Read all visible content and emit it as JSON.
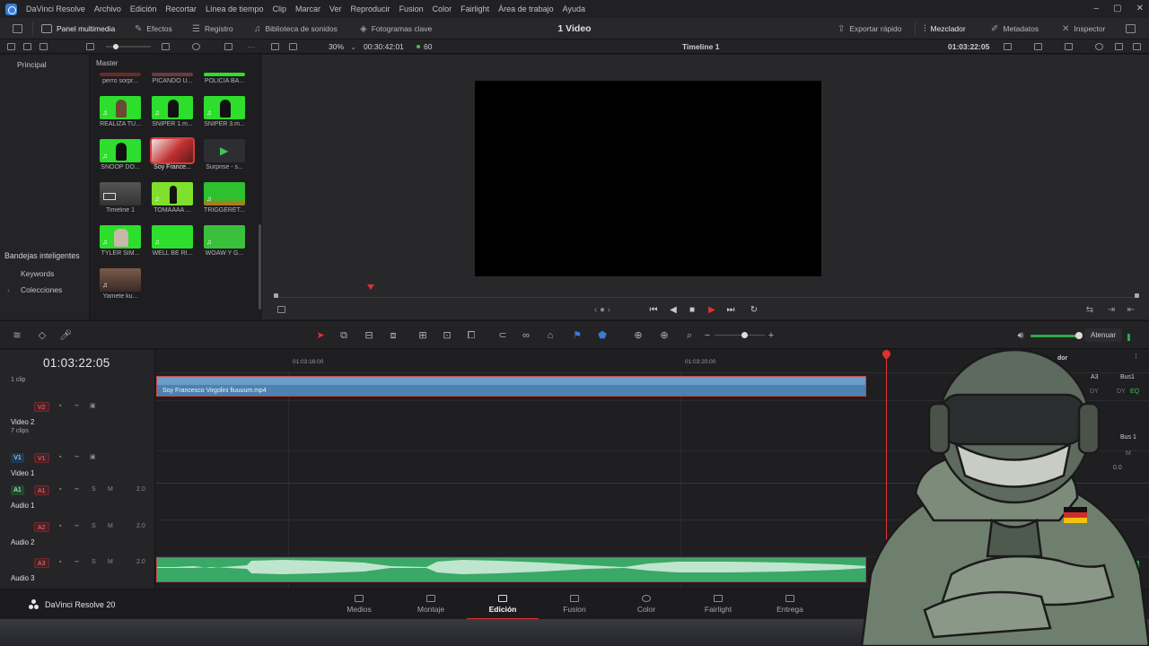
{
  "app": {
    "name": "DaVinci Resolve",
    "menu": [
      "Archivo",
      "Edición",
      "Recortar",
      "Línea de tiempo",
      "Clip",
      "Marcar",
      "Ver",
      "Reproducir",
      "Fusion",
      "Color",
      "Fairlight",
      "Área de trabajo",
      "Ayuda"
    ],
    "window_controls": [
      "–",
      "▢",
      "✕"
    ]
  },
  "toolbar": {
    "left": [
      "Panel multimedia",
      "Efectos",
      "Registro",
      "Biblioteca de sonidos",
      "Fotogramas clave"
    ],
    "project_title": "1 Video",
    "right": [
      "Exportar rápido",
      "Mezclador",
      "Metadatos",
      "Inspector"
    ]
  },
  "subtoolbar": {
    "zoom": "30%",
    "source_timecode": "00:30:42:01",
    "fps": "60",
    "timeline_name": "Timeline 1",
    "record_timecode": "01:03:22:05"
  },
  "left_panel": {
    "principal": "Principal",
    "smart_bins_title": "Bandejas inteligentes",
    "smart_bins": [
      "Keywords",
      "Colecciones"
    ]
  },
  "media_pool": {
    "bin": "Master",
    "clips": [
      {
        "name": "perro sorpr...",
        "kind": "partial"
      },
      {
        "name": "PICANDO U...",
        "kind": "partial"
      },
      {
        "name": "POLICIA BA...",
        "kind": "partial"
      },
      {
        "name": "REALIZA TU...",
        "kind": "green"
      },
      {
        "name": "SNIPER 1.m...",
        "kind": "green"
      },
      {
        "name": "SNIPER 3.m...",
        "kind": "green"
      },
      {
        "name": "SNOOP DO...",
        "kind": "green"
      },
      {
        "name": "Soy France...",
        "kind": "selected"
      },
      {
        "name": "Surprise - s...",
        "kind": "audio"
      },
      {
        "name": "Timeline 1",
        "kind": "timeline"
      },
      {
        "name": "TOMAAAA ...",
        "kind": "green"
      },
      {
        "name": "TRIGGERET...",
        "kind": "green"
      },
      {
        "name": "TYLER SIM...",
        "kind": "green"
      },
      {
        "name": "WELL BE RI...",
        "kind": "green"
      },
      {
        "name": "WOAW Y G...",
        "kind": "green"
      },
      {
        "name": "Yamete ku...",
        "kind": "photo"
      }
    ]
  },
  "timeline": {
    "timecode": "01:03:22:05",
    "ruler": [
      "01:03:16:00",
      "01:03:20:00"
    ],
    "tracks": [
      {
        "id": "V2",
        "name": "Video 2",
        "sub": "7 clips",
        "top_note": "1 clip"
      },
      {
        "id": "V1",
        "name": "Video 1",
        "sub": ""
      },
      {
        "id": "A1",
        "name": "Audio 1",
        "level": "2.0"
      },
      {
        "id": "A2",
        "name": "Audio 2",
        "level": "2.0"
      },
      {
        "id": "A3",
        "name": "Audio 3",
        "level": "2.0"
      }
    ],
    "video_clip_name": "Soy Francesco Virgolini fiuuuum.mp4",
    "attenuate": "Atenuar"
  },
  "mixer": {
    "title": "dor",
    "a3": "A3",
    "bus1": "Bus1",
    "bus1b": "Bus 1",
    "dy": "DY",
    "eq": "EQ",
    "m": "M",
    "value": "0.0"
  },
  "pages": {
    "brand": "DaVinci Resolve 20",
    "tabs": [
      "Medios",
      "Montaje",
      "Edición",
      "Fusion",
      "Color",
      "Fairlight",
      "Entrega"
    ],
    "active": "Edición"
  },
  "colors": {
    "accent_red": "#e03030",
    "clip_blue": "#4b82b2",
    "clip_green": "#3aa867",
    "chroma_green": "#2dde2d"
  }
}
